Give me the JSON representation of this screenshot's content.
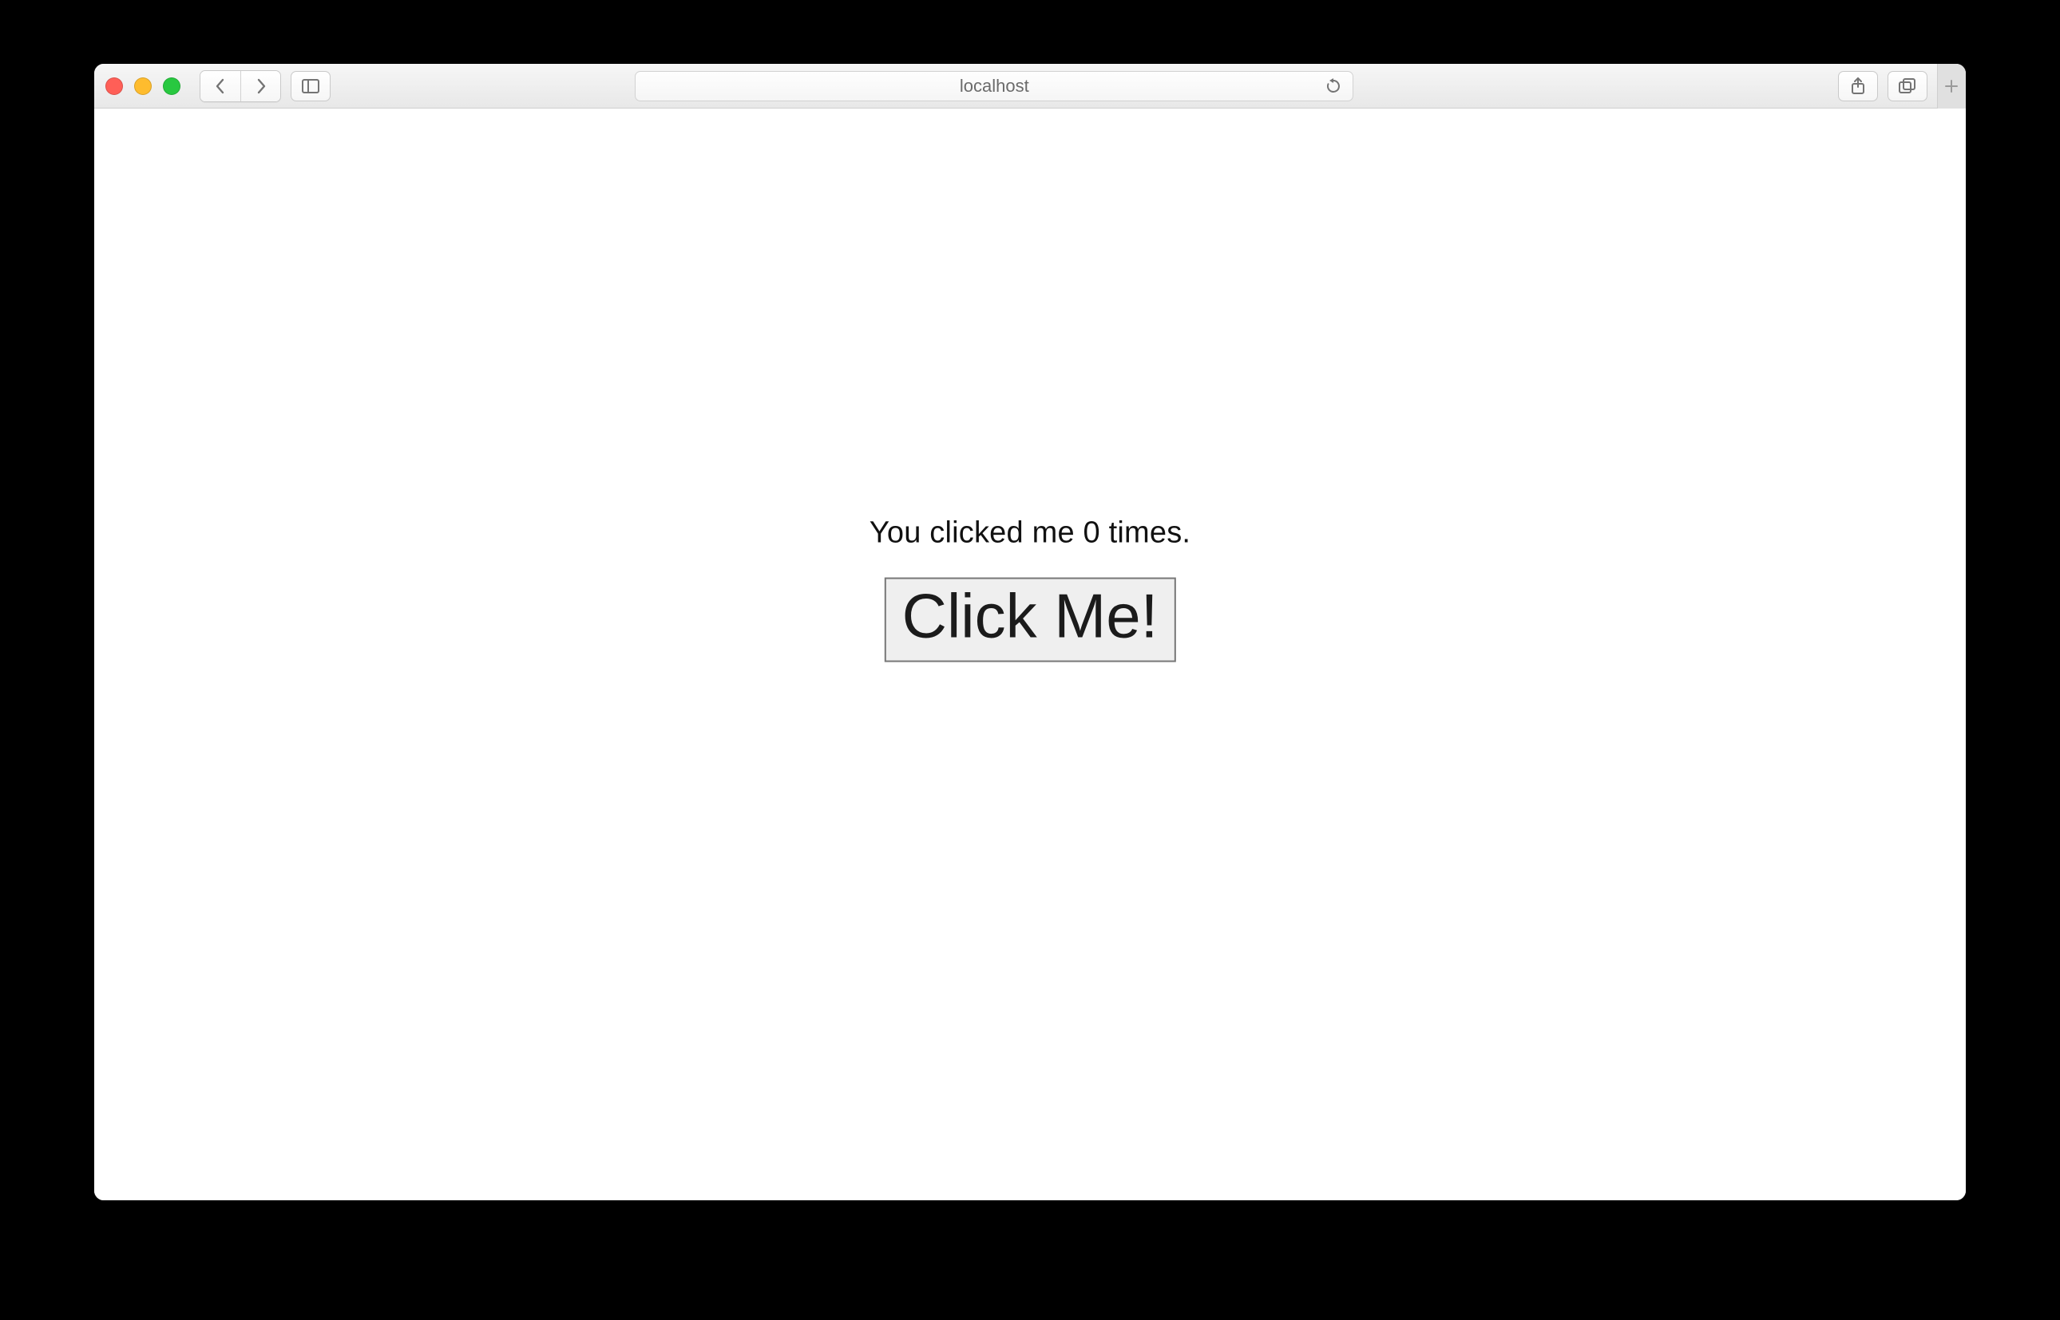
{
  "browser": {
    "address": "localhost"
  },
  "page": {
    "status_text": "You clicked me 0 times.",
    "button_label": "Click Me!"
  }
}
